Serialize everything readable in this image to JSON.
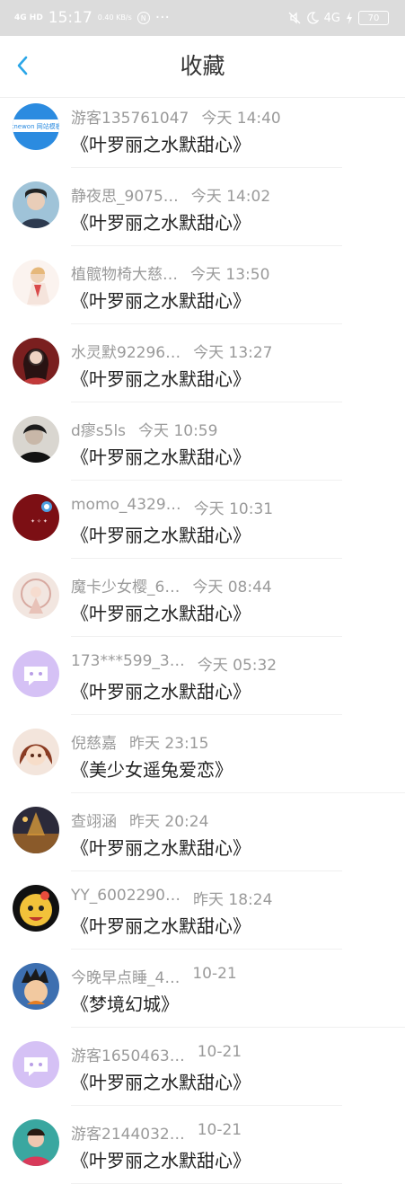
{
  "status_bar": {
    "time": "15:17",
    "signal": "4G HD",
    "speed": "0.40 KB/s",
    "badge": "N",
    "more": "···",
    "right_signal": "4G",
    "battery": "70"
  },
  "header": {
    "title": "收藏"
  },
  "items": [
    {
      "name": "游客135761047",
      "time": "今天 14:40",
      "book": "《叶罗丽之水默甜心》"
    },
    {
      "name": "静夜思_9075…",
      "time": "今天 14:02",
      "book": "《叶罗丽之水默甜心》"
    },
    {
      "name": "植髋物椅大慈…",
      "time": "今天 13:50",
      "book": "《叶罗丽之水默甜心》"
    },
    {
      "name": "水灵默92296…",
      "time": "今天 13:27",
      "book": "《叶罗丽之水默甜心》"
    },
    {
      "name": "d瘳s5ls",
      "time": "今天 10:59",
      "book": "《叶罗丽之水默甜心》"
    },
    {
      "name": "momo_4329…",
      "time": "今天 10:31",
      "book": "《叶罗丽之水默甜心》"
    },
    {
      "name": "魔卡少女樱_6…",
      "time": "今天 08:44",
      "book": "《叶罗丽之水默甜心》"
    },
    {
      "name": "173***599_3…",
      "time": "今天 05:32",
      "book": "《叶罗丽之水默甜心》"
    },
    {
      "name": "倪慈嘉",
      "time": "昨天 23:15",
      "book": "《美少女遥兔爱恋》"
    },
    {
      "name": "查翊涵",
      "time": "昨天 20:24",
      "book": "《叶罗丽之水默甜心》"
    },
    {
      "name": "YY_6002290…",
      "time": "昨天 18:24",
      "book": "《叶罗丽之水默甜心》"
    },
    {
      "name": "今晚早点睡_4…",
      "time": "10-21",
      "book": "《梦境幻城》"
    },
    {
      "name": "游客1650463…",
      "time": "10-21",
      "book": "《叶罗丽之水默甜心》"
    },
    {
      "name": "游客2144032…",
      "time": "10-21",
      "book": "《叶罗丽之水默甜心》"
    }
  ],
  "avatar_logo_text": "knewon 网站模板"
}
